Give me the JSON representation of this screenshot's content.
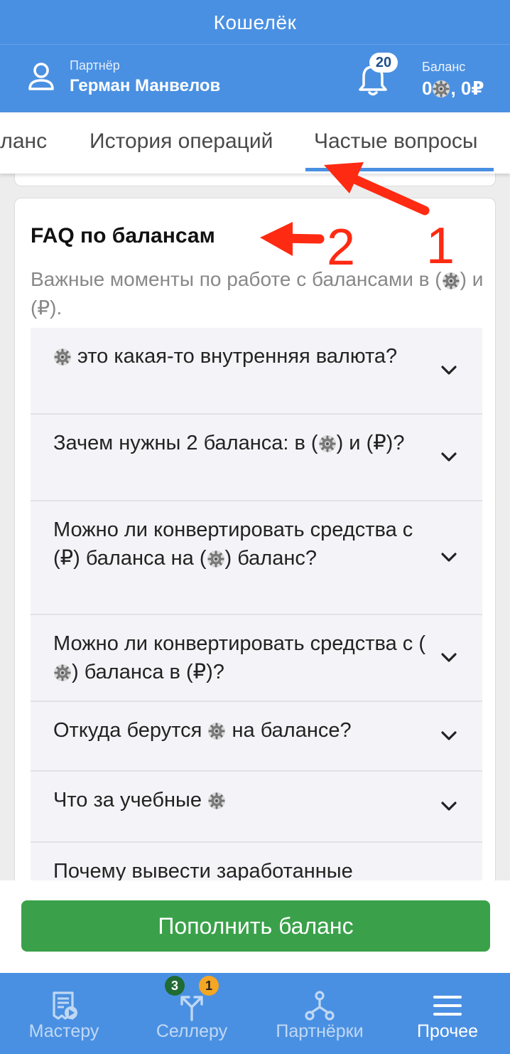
{
  "app": {
    "title": "Кошелёк",
    "partner_label": "Партнёр",
    "partner_name": "Герман Манвелов",
    "notifications_count": "20",
    "balance_label": "Баланс",
    "balance_coin_prefix": "0",
    "balance_rub": ", 0₽"
  },
  "tabs": [
    {
      "label": "Баланс"
    },
    {
      "label": "История операций"
    },
    {
      "label": "Частые вопросы",
      "active": true
    }
  ],
  "faq": {
    "title": "FAQ по балансам",
    "subtitle_part1": "Важные моменты по работе с балансами в (",
    "subtitle_part2": ") и (₽).",
    "items": [
      {
        "q_after_icon": " это какая-то внутренняя валюта?"
      },
      {
        "q_before_icon": "Зачем нужны 2 баланса: в (",
        "q_after_icon": ") и (₽)?"
      },
      {
        "q_before_icon": "Можно ли конвертировать средства с (₽) баланса на (",
        "q_after_icon": ") баланс?"
      },
      {
        "q_before_icon": "Можно ли конвертировать средства с (",
        "q_after_icon": ") баланса в (₽)?"
      },
      {
        "q_before_icon": "Откуда берутся ",
        "q_after_icon": " на балансе?"
      },
      {
        "q_before_icon": "Что за учебные ",
        "q_after_icon": ""
      },
      {
        "q_text": "Почему вывести заработанные"
      }
    ]
  },
  "annotations": {
    "one": "1",
    "two": "2"
  },
  "actions": {
    "topup_label": "Пополнить баланс"
  },
  "bottom_nav": {
    "items": [
      {
        "label": "Мастеру"
      },
      {
        "label": "Селлеру",
        "badge_green": "3",
        "badge_orange": "1"
      },
      {
        "label": "Партнёрки"
      },
      {
        "label": "Прочее",
        "active": true
      }
    ]
  },
  "colors": {
    "brand_blue": "#4a90e2",
    "button_green": "#3aa14a",
    "annotation_red": "#ff2a12",
    "badge_green": "#1f6b33",
    "badge_orange": "#f5a623"
  },
  "icons": [
    "user-icon",
    "bell-icon",
    "gear-coin-icon",
    "chevron-down-icon",
    "receipt-icon",
    "fork-icon",
    "share-nodes-icon",
    "menu-icon",
    "arrow-icon"
  ]
}
